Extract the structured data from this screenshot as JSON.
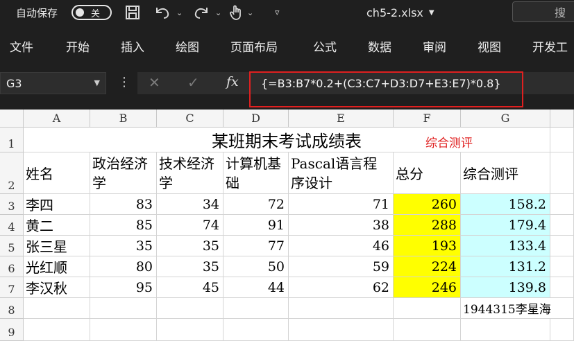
{
  "titlebar": {
    "autosave_label": "自动保存",
    "autosave_state": "关",
    "save_icon": "save-icon",
    "undo_icon": "undo-icon",
    "redo_icon": "redo-icon",
    "touch_icon": "touch-mode-icon",
    "filename": "ch5-2.xlsx",
    "search_placeholder": "搜"
  },
  "ribbon": {
    "tabs": [
      "文件",
      "开始",
      "插入",
      "绘图",
      "页面布局",
      "公式",
      "数据",
      "审阅",
      "视图",
      "开发工"
    ]
  },
  "formula_bar": {
    "namebox": "G3",
    "fx": "fx",
    "formula": "{=B3:B7*0.2+(C3:C7+D3:D7+E3:E7)*0.8}"
  },
  "sheet": {
    "columns": [
      "A",
      "B",
      "C",
      "D",
      "E",
      "F",
      "G"
    ],
    "rows": [
      "1",
      "2",
      "3",
      "4",
      "5",
      "6",
      "7",
      "8",
      "9"
    ],
    "title": "某班期末考试成绩表",
    "annotation": "综合测评",
    "headers": {
      "name": "姓名",
      "politics": "政治经济学",
      "tech": "技术经济学",
      "computer": "计算机基础",
      "pascal": "Pascal语言程序设计",
      "total": "总分",
      "eval": "综合测评"
    },
    "data_rows": [
      {
        "name": "李四",
        "b": "83",
        "c": "34",
        "d": "72",
        "e": "71",
        "f": "260",
        "g": "158.2"
      },
      {
        "name": "黄二",
        "b": "85",
        "c": "74",
        "d": "91",
        "e": "38",
        "f": "288",
        "g": "179.4"
      },
      {
        "name": "张三星",
        "b": "35",
        "c": "35",
        "d": "77",
        "e": "46",
        "f": "193",
        "g": "133.4"
      },
      {
        "name": "光红顺",
        "b": "80",
        "c": "35",
        "d": "50",
        "e": "59",
        "f": "224",
        "g": "131.2"
      },
      {
        "name": "李汉秋",
        "b": "95",
        "c": "45",
        "d": "44",
        "e": "62",
        "f": "246",
        "g": "139.8"
      }
    ],
    "note": "1944315李星海"
  },
  "colors": {
    "total_fill": "#ffff00",
    "eval_fill": "#ccffff",
    "highlight": "#e02020"
  }
}
